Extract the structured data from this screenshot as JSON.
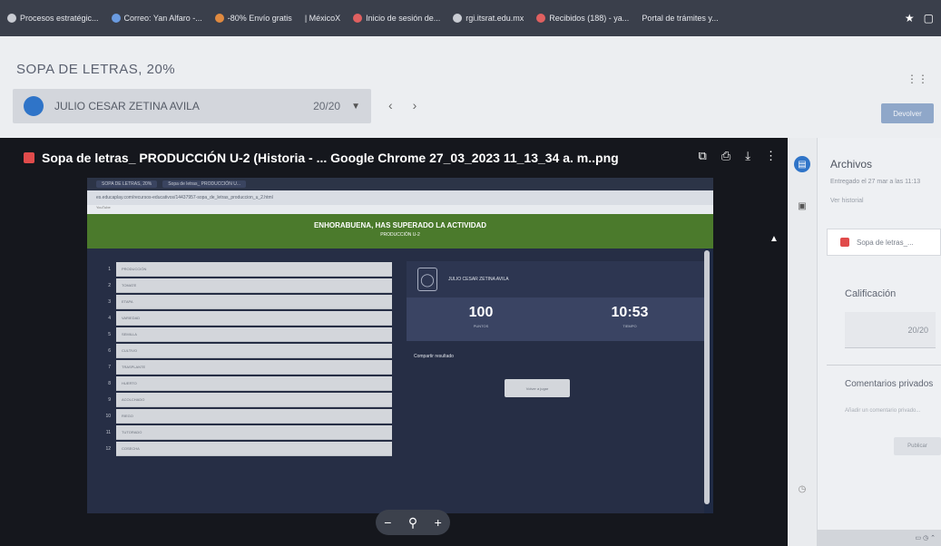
{
  "bookmarks": [
    {
      "label": "Procesos estratégic...",
      "icon": "globe-icon"
    },
    {
      "label": "Correo: Yan Alfaro -...",
      "icon": "outlook-icon"
    },
    {
      "label": "-80% Envío gratis",
      "icon": "shop-icon"
    },
    {
      "label": "| MéxicoX",
      "icon": ""
    },
    {
      "label": "Inicio de sesión de...",
      "icon": "login-icon"
    },
    {
      "label": "rgi.itsrat.edu.mx",
      "icon": "globe-icon"
    },
    {
      "label": "Recibidos (188) - ya...",
      "icon": "mail-icon"
    },
    {
      "label": "Portal de trámites y...",
      "icon": ""
    }
  ],
  "header": {
    "assignment_title": "SOPA DE LETRAS, 20%",
    "student_name": "JULIO CESAR ZETINA AVILA",
    "grade": "20/20",
    "return_button": "Devolver"
  },
  "viewer": {
    "file_name": "Sopa de letras_ PRODUCCIÓN U-2 (Historia - ... Google Chrome 27_03_2023 11_13_34 a. m..png",
    "screenshot": {
      "tabs": [
        "SOPA DE LETRAS, 20%",
        "Sopa de letras_ PRODUCCIÓN U..."
      ],
      "address": "es.educaplay.com/recursos-educativos/14437957-sopa_de_letras_produccion_u_2.html",
      "bookmark_bar": "YouTube",
      "congrats_title": "ENHORABUENA, HAS SUPERADO LA ACTIVIDAD",
      "congrats_subtitle": "PRODUCCIÓN U-2",
      "words": [
        {
          "num": "1",
          "text": "PRODUCCIÓN"
        },
        {
          "num": "2",
          "text": "TOMATE"
        },
        {
          "num": "3",
          "text": "ETAPA"
        },
        {
          "num": "4",
          "text": "VARIEDAD"
        },
        {
          "num": "5",
          "text": "SEMILLA"
        },
        {
          "num": "6",
          "text": "CULTIVO"
        },
        {
          "num": "7",
          "text": "TRASPLANTE"
        },
        {
          "num": "8",
          "text": "HUERTO"
        },
        {
          "num": "9",
          "text": "ACOLCHADO"
        },
        {
          "num": "10",
          "text": "RIEGO"
        },
        {
          "num": "11",
          "text": "TUTORADO"
        },
        {
          "num": "12",
          "text": "COSECHA"
        }
      ],
      "result_name": "JULIO CESAR ZETINA AVILA",
      "score": "100",
      "score_label": "PUNTOS",
      "time": "10:53",
      "time_label": "TIEMPO",
      "share_label": "Compartir resultado",
      "retry_button": "Volver a jugar"
    },
    "zoom_out": "−",
    "zoom_icon": "magnifier-icon",
    "zoom_in": "+"
  },
  "panel": {
    "heading": "Archivos",
    "submitted_text": "Entregado el 27 mar a las 11:13",
    "history_link": "Ver historial",
    "file_chip": "Sopa de letras_...",
    "grade_label": "Calificación",
    "grade_value": "20/20",
    "comments_label": "Comentarios privados",
    "comment_placeholder": "Añadir un comentario privado...",
    "publish_button": "Publicar"
  },
  "colors": {
    "congrats_green": "#4b7a2c",
    "file_red": "#e04b4b",
    "avatar_blue": "#2f74c8",
    "viewer_dark": "#15171d"
  }
}
